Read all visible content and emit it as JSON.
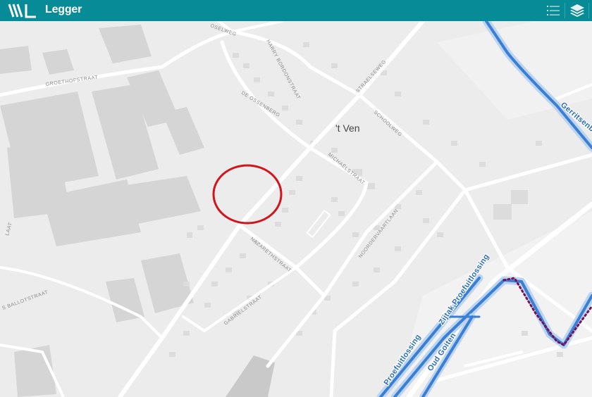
{
  "app": {
    "title": "Legger",
    "logo_text": "WL"
  },
  "toolbar": {
    "legend_icon": "list-icon",
    "layers_icon": "layers-icon"
  },
  "map": {
    "place_label": "'t Ven",
    "streets": {
      "groethofstraat": "GROETHOFSTRAAT",
      "harry_bordonstraat": "HARRY BORDONSTRAAT",
      "de_ossenberg": "DE OSSENBERG",
      "straelseweg": "STRAELSEWEG",
      "schoolweg": "SCHOOLWEG",
      "michaelstraat": "MICHAËLSTRAAT",
      "nazarethstraat": "NAZARETHSTRAAT",
      "noorderwaartlaan": "NOORDERVAARTLAAN",
      "gabrielstraat": "GABRIELSTRAAT",
      "ballotstraat": "S BALLOTSTRAAT",
      "oselweg": "OSELWEG",
      "left_edge": "LAAT"
    },
    "waterways": {
      "gerritsenbeek": "Gerritsenbeek",
      "zijtak_proefuitlossing": "Zijtak Proefuitlossing",
      "proefuitlossing": "Proefuitlossing",
      "oud_goiten": "Oud Goiten"
    },
    "colors": {
      "waterway": "#3a7fd6",
      "waterway_halo": "#bcd4f0",
      "marker_circle": "#d4141b",
      "selected_path": "#7a1054",
      "topbar": "#078b96"
    }
  }
}
